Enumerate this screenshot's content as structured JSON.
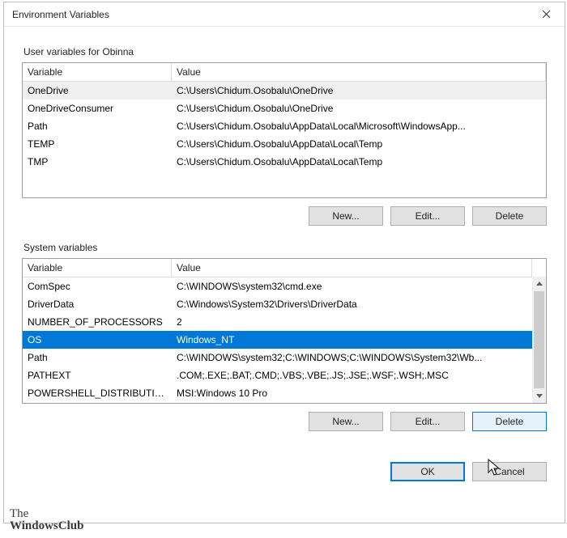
{
  "title": "Environment Variables",
  "user_group_title": "User variables for Obinna",
  "system_group_title": "System variables",
  "columns": {
    "variable": "Variable",
    "value": "Value"
  },
  "user_vars": [
    {
      "name": "OneDrive",
      "value": "C:\\Users\\Chidum.Osobalu\\OneDrive",
      "selected": "grey"
    },
    {
      "name": "OneDriveConsumer",
      "value": "C:\\Users\\Chidum.Osobalu\\OneDrive"
    },
    {
      "name": "Path",
      "value": "C:\\Users\\Chidum.Osobalu\\AppData\\Local\\Microsoft\\WindowsApp..."
    },
    {
      "name": "TEMP",
      "value": "C:\\Users\\Chidum.Osobalu\\AppData\\Local\\Temp"
    },
    {
      "name": "TMP",
      "value": "C:\\Users\\Chidum.Osobalu\\AppData\\Local\\Temp"
    }
  ],
  "system_vars": [
    {
      "name": "ComSpec",
      "value": "C:\\WINDOWS\\system32\\cmd.exe"
    },
    {
      "name": "DriverData",
      "value": "C:\\Windows\\System32\\Drivers\\DriverData"
    },
    {
      "name": "NUMBER_OF_PROCESSORS",
      "value": "2"
    },
    {
      "name": "OS",
      "value": "Windows_NT",
      "selected": "blue"
    },
    {
      "name": "Path",
      "value": "C:\\WINDOWS\\system32;C:\\WINDOWS;C:\\WINDOWS\\System32\\Wb..."
    },
    {
      "name": "PATHEXT",
      "value": ".COM;.EXE;.BAT;.CMD;.VBS;.VBE;.JS;.JSE;.WSF;.WSH;.MSC"
    },
    {
      "name": "POWERSHELL_DISTRIBUTIO...",
      "value": "MSI:Windows 10 Pro"
    }
  ],
  "buttons": {
    "new": "New...",
    "edit": "Edit...",
    "delete": "Delete",
    "ok": "OK",
    "cancel": "Cancel"
  },
  "watermark": {
    "line1": "The",
    "line2": "WindowsClub"
  }
}
